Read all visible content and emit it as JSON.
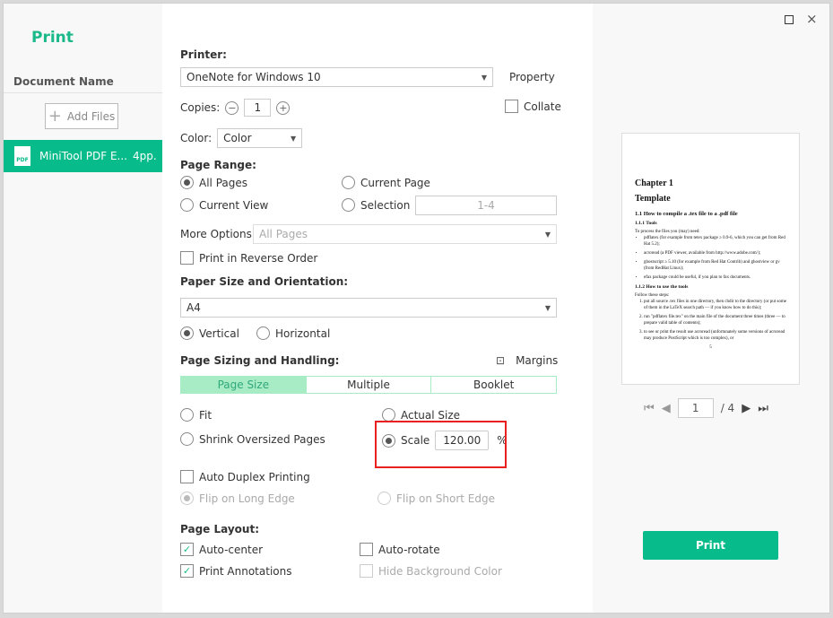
{
  "app": {
    "title": "Print"
  },
  "sidebar": {
    "header": "Document Name",
    "add_files": "Add Files",
    "documents": [
      {
        "name": "MiniTool PDF E...",
        "pages": "4pp.",
        "icon": "pdf-file-icon"
      }
    ]
  },
  "printer": {
    "label": "Printer:",
    "value": "OneNote for Windows 10",
    "property": "Property"
  },
  "copies": {
    "label": "Copies:",
    "value": "1",
    "collate": "Collate",
    "collate_checked": false
  },
  "color": {
    "label": "Color:",
    "value": "Color"
  },
  "page_range": {
    "label": "Page Range:",
    "all_pages": "All Pages",
    "current_page": "Current Page",
    "current_view": "Current View",
    "selection": "Selection",
    "selection_value": "1-4",
    "selected": "All Pages"
  },
  "more_options": {
    "label": "More Options:",
    "value": "All Pages",
    "reverse": "Print in Reverse Order"
  },
  "paper": {
    "label": "Paper Size and Orientation:",
    "size": "A4",
    "vertical": "Vertical",
    "horizontal": "Horizontal",
    "selected": "Vertical"
  },
  "sizing": {
    "label": "Page Sizing and Handling:",
    "margins": "Margins",
    "tabs": [
      "Page Size",
      "Multiple",
      "Booklet"
    ],
    "active_tab": "Page Size",
    "fit": "Fit",
    "actual_size": "Actual Size",
    "shrink": "Shrink Oversized Pages",
    "scale": "Scale",
    "scale_value": "120.00",
    "percent": "%",
    "selected": "Scale"
  },
  "duplex": {
    "label": "Auto Duplex Printing",
    "long_edge": "Flip on Long Edge",
    "short_edge": "Flip on Short Edge"
  },
  "layout": {
    "label": "Page Layout:",
    "auto_center": "Auto-center",
    "auto_rotate": "Auto-rotate",
    "print_annotations": "Print Annotations",
    "hide_bg": "Hide Background Color"
  },
  "preview": {
    "chapter": "Chapter 1",
    "title": "Template",
    "s1": "1.1    How to compile a .tex file to a .pdf file",
    "s11": "1.1.1    Tools",
    "p1": "To process the files you (may) need:",
    "b1": "pdflatex (for example from tetex package ≥ 0.9-6, which you can get from Red Hat 5.2);",
    "b2": "acroread (a PDF viewer, available from http://www.adobe.com/);",
    "b3": "ghostscript ≥ 5.10 (for example from Red Hat Contrib) and ghostview or gv (from RedHat Linux);",
    "b4": "efax package could be useful, if you plan to fax documents.",
    "s12": "1.1.2    How to use the tools",
    "p2": "Follow these steps:",
    "n1": "put all source .tex files in one directory, then chdir to the directory (or put some of them in the LaTeX search path — if you know how to do this);",
    "n2": "run \"pdflatex file.tex\" on the main file of the document three times (three — to prepare valid table of contents);",
    "n3": "to see or print the result use acroread (unfortunately some versions of acroread may produce PostScript which is too complex), or",
    "page_num": "5",
    "current_page": "1",
    "total": "/ 4"
  },
  "print_button": "Print",
  "colors": {
    "accent": "#07bb8a",
    "highlight": "#e8201f",
    "tab_active": "#a8ecc6"
  }
}
